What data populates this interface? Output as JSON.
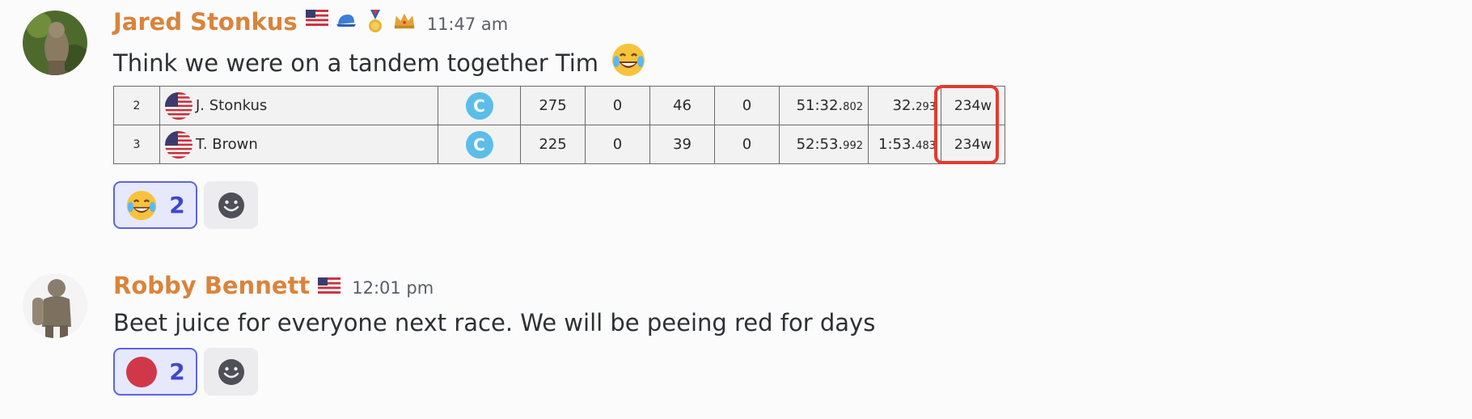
{
  "messages": [
    {
      "author": "Jared Stonkus",
      "badges": [
        "us-flag-icon",
        "blue-cap-icon",
        "medal-icon",
        "crown-icon"
      ],
      "timestamp": "11:47 am",
      "text": "Think we were on a tandem together Tim",
      "text_emoji": "laughing-tears-emoji",
      "results": [
        {
          "position": "2",
          "rider": "J. Stonkus",
          "category": "C",
          "col1": "275",
          "col2": "0",
          "col3": "46",
          "col4": "0",
          "time": "51:32.",
          "time_ms": "802",
          "gap": "32.",
          "gap_ms": "293",
          "watts": "234w"
        },
        {
          "position": "3",
          "rider": "T. Brown",
          "category": "C",
          "col1": "225",
          "col2": "0",
          "col3": "39",
          "col4": "0",
          "time": "52:53.",
          "time_ms": "992",
          "gap": "1:53.",
          "gap_ms": "483",
          "watts": "234w"
        }
      ],
      "reaction": {
        "emoji": "laughing-tears-emoji",
        "count": "2"
      }
    },
    {
      "author": "Robby Bennett",
      "badges": [
        "us-flag-icon"
      ],
      "timestamp": "12:01 pm",
      "text": "Beet juice for everyone next race. We will be peeing red for days",
      "reaction": {
        "emoji": "red-circle-emoji",
        "count": "2"
      }
    }
  ],
  "colors": {
    "author": "#d9843c",
    "timestamp": "#5c5e66",
    "reaction_border": "#5b65e0",
    "reaction_bg": "#e6e8fb",
    "highlight": "#e23b2f",
    "category_c": "#5cbde8"
  }
}
